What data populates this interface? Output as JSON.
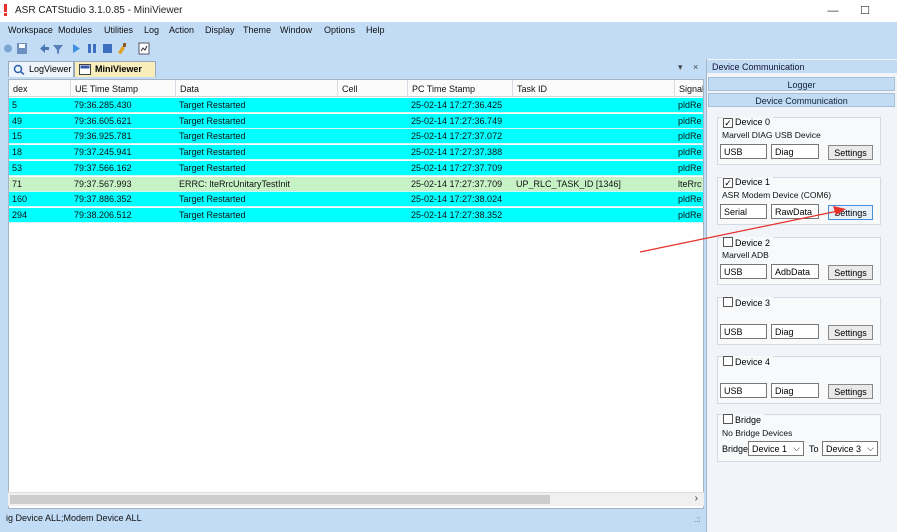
{
  "window": {
    "title": "ASR CATStudio 3.1.0.85 - MiniViewer",
    "minimize_glyph": "—",
    "maximize_glyph": "☐"
  },
  "menu": [
    "Workspace",
    "Modules",
    "Utilities",
    "Log",
    "Action",
    "Display",
    "Theme",
    "Window",
    "Options",
    "Help"
  ],
  "tabs": [
    {
      "label": "LogViewer",
      "icon": "magnifier-icon"
    },
    {
      "label": "MiniViewer",
      "icon": "mini-viewer-icon"
    }
  ],
  "pane_controls": {
    "pin": "▾",
    "close": "×"
  },
  "grid": {
    "columns": [
      "dex",
      "UE Time Stamp",
      "Data",
      "Cell",
      "PC Time Stamp",
      "Task ID",
      "Signal"
    ],
    "rows": [
      {
        "idx": "5",
        "ue": "79:36.285.430",
        "data": "Target Restarted",
        "cell": "",
        "pc": "25-02-14 17:27:36.425",
        "task": "",
        "signal": "pldRe",
        "color": "cyan"
      },
      {
        "idx": "49",
        "ue": "79:36.605.621",
        "data": "Target Restarted",
        "cell": "",
        "pc": "25-02-14 17:27:36.749",
        "task": "",
        "signal": "pldRe",
        "color": "cyan"
      },
      {
        "idx": "15",
        "ue": "79:36.925.781",
        "data": "Target Restarted",
        "cell": "",
        "pc": "25-02-14 17:27:37.072",
        "task": "",
        "signal": "pldRe",
        "color": "cyan"
      },
      {
        "idx": "18",
        "ue": "79:37.245.941",
        "data": "Target Restarted",
        "cell": "",
        "pc": "25-02-14 17:27:37.388",
        "task": "",
        "signal": "pldRe",
        "color": "cyan"
      },
      {
        "idx": "53",
        "ue": "79:37.566.162",
        "data": "Target Restarted",
        "cell": "",
        "pc": "25-02-14 17:27:37.709",
        "task": "",
        "signal": "pldRe",
        "color": "cyan"
      },
      {
        "idx": "71",
        "ue": "79:37.567.993",
        "data": "ERRC: lteRrcUnitaryTestInit",
        "cell": "",
        "pc": "25-02-14 17:27:37.709",
        "task": "UP_RLC_TASK_ID [1346]",
        "signal": "lteRrc",
        "color": "green"
      },
      {
        "idx": "160",
        "ue": "79:37.886.352",
        "data": "Target Restarted",
        "cell": "",
        "pc": "25-02-14 17:27:38.024",
        "task": "",
        "signal": "pldRe",
        "color": "cyan"
      },
      {
        "idx": "294",
        "ue": "79:38.206.512",
        "data": "Target Restarted",
        "cell": "",
        "pc": "25-02-14 17:27:38.352",
        "task": "",
        "signal": "pldRe",
        "color": "cyan"
      }
    ],
    "scroll_right": "›"
  },
  "status": {
    "text": "ig Device ALL;Modem Device ALL",
    "grip": ".::"
  },
  "right_panel": {
    "title": "Device Communication",
    "strips": [
      "Logger",
      "Device Communication"
    ],
    "devices": [
      {
        "name": "Device 0",
        "checked": true,
        "check_glyph": "✓",
        "desc": "Marvell DIAG USB Device",
        "conn": "USB",
        "mode": "Diag",
        "button": "Settings"
      },
      {
        "name": "Device 1",
        "checked": true,
        "check_glyph": "✓",
        "desc": "ASR Modem Device (COM6)",
        "conn": "Serial",
        "mode": "RawData",
        "button": "Settings"
      },
      {
        "name": "Device 2",
        "checked": false,
        "check_glyph": "",
        "desc": "Marvell ADB",
        "conn": "USB",
        "mode": "AdbData",
        "button": "Settings"
      },
      {
        "name": "Device 3",
        "checked": false,
        "check_glyph": "",
        "desc": "",
        "conn": "USB",
        "mode": "Diag",
        "button": "Settings"
      },
      {
        "name": "Device 4",
        "checked": false,
        "check_glyph": "",
        "desc": "",
        "conn": "USB",
        "mode": "Diag",
        "button": "Settings"
      }
    ],
    "bridge": {
      "name": "Bridge",
      "desc": "No Bridge Devices",
      "label": "Bridge",
      "from": "Device 1",
      "to_label": "To",
      "to": "Device 3",
      "arrow": "⌵"
    }
  },
  "colors": {
    "frame": "#c3dcf6",
    "row_cyan": "#00ffff",
    "row_green": "#c6f2c6",
    "annotation_arrow": "#e8302a"
  }
}
